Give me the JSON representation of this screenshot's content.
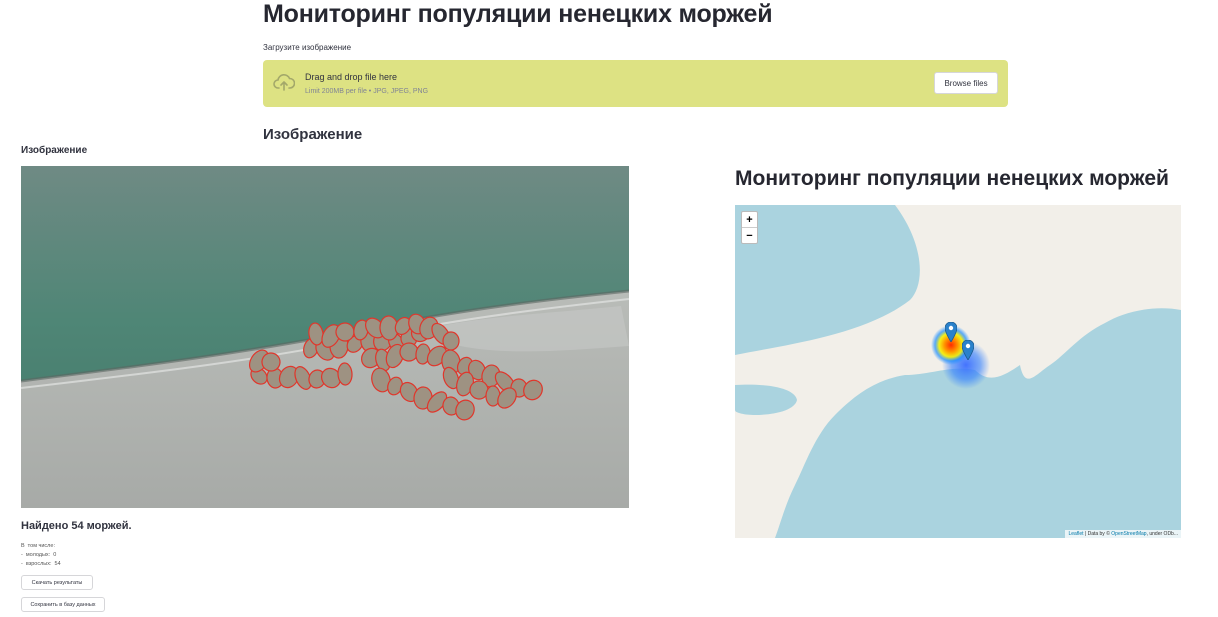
{
  "page": {
    "title": "Мониторинг популяции ненецких моржей"
  },
  "uploader": {
    "label": "Загрузите изображение",
    "icon": "cloud-upload-icon",
    "drop_text": "Drag and drop file here",
    "limit_text": "Limit 200MB per file • JPG, JPEG, PNG",
    "browse_label": "Browse files",
    "bg_color": "#dde283"
  },
  "section": {
    "heading": "Изображение",
    "image_caption": "Изображение"
  },
  "results": {
    "found_text": "Найдено 54 моржей.",
    "stats": [
      {
        "prefix": "В",
        "label": "том числе:",
        "value": ""
      },
      {
        "prefix": "-",
        "label": "молодых:",
        "value": "0"
      },
      {
        "prefix": "-",
        "label": "взрослых:",
        "value": "54"
      }
    ],
    "download_label": "Скачать результаты",
    "save_label": "Сохранить в базу данных"
  },
  "map": {
    "title": "Мониторинг популяции ненецких моржей",
    "zoom_in": "+",
    "zoom_out": "−",
    "attribution_leaflet": "Leaflet",
    "attribution_mid": " | Data by © ",
    "attribution_osm": "OpenStreetMap",
    "attribution_tail": ", under ODb...",
    "water_color": "#aad3df",
    "land_color": "#f2efe9",
    "marker_icons": [
      "map-pin-icon",
      "map-pin-icon"
    ]
  }
}
